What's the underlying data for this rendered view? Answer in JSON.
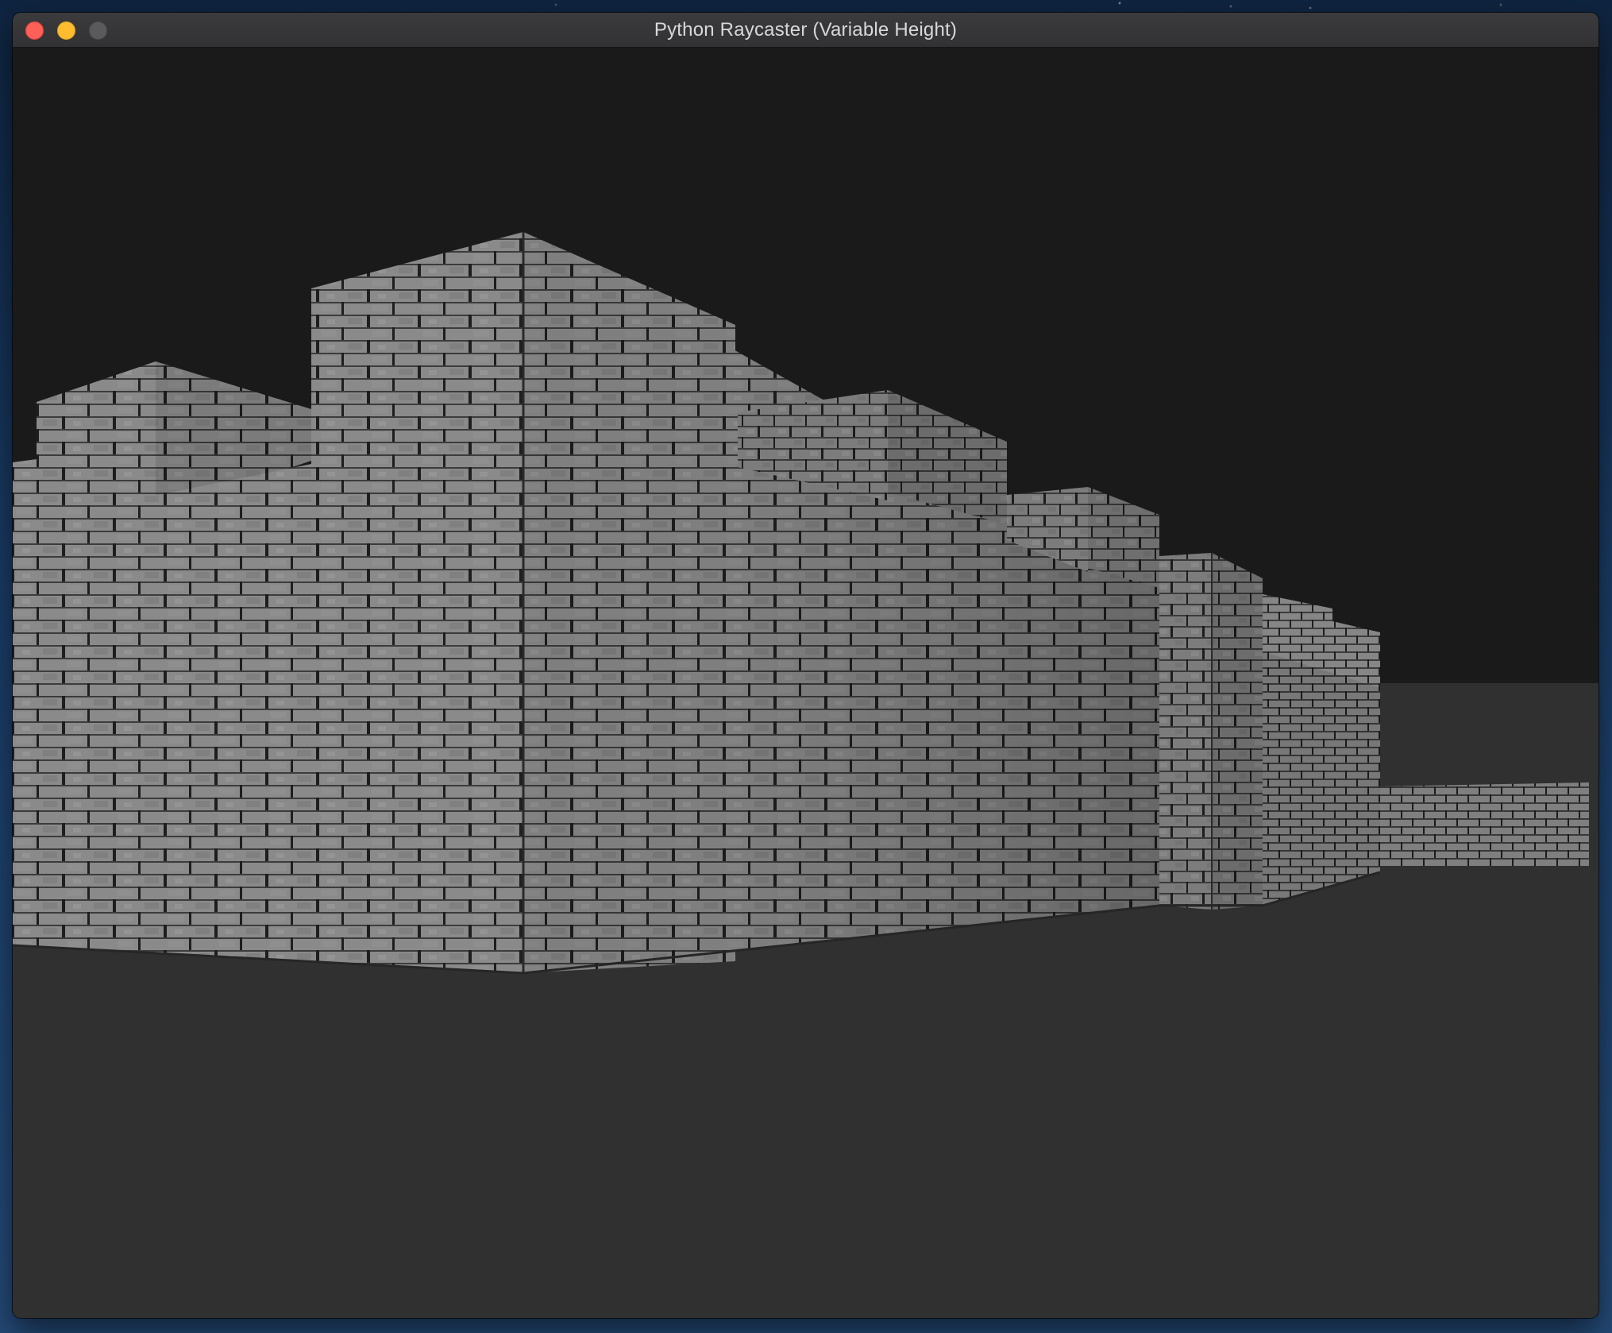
{
  "window": {
    "title": "Python Raycaster (Variable Height)",
    "controls": [
      "close-button",
      "minimize-button",
      "zoom-button"
    ]
  },
  "scene": {
    "ceiling_color": "#1a1a1a",
    "floor_color": "#303030",
    "wall_texture": "gray-brick",
    "wall_base_color": "#808080",
    "mortar_color": "#5a5a5a"
  }
}
